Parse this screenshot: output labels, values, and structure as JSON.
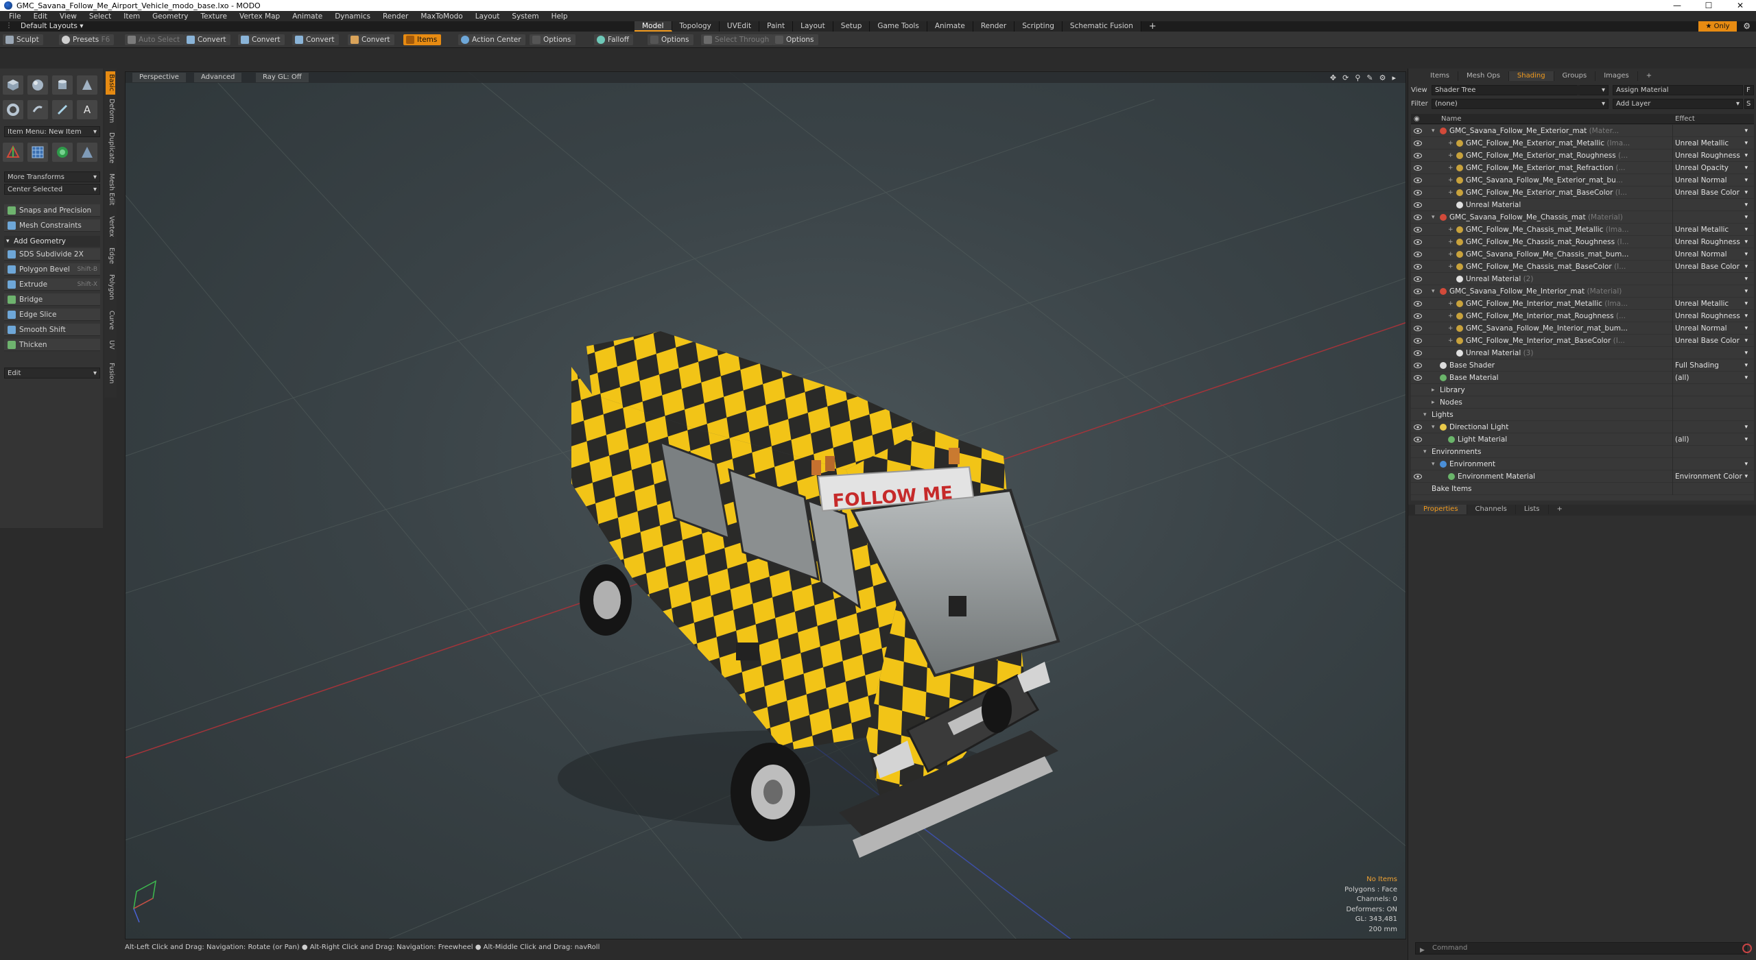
{
  "window": {
    "title": "GMC_Savana_Follow_Me_Airport_Vehicle_modo_base.lxo - MODO"
  },
  "menu": [
    "File",
    "Edit",
    "View",
    "Select",
    "Item",
    "Geometry",
    "Texture",
    "Vertex Map",
    "Animate",
    "Dynamics",
    "Render",
    "MaxToModo",
    "Layout",
    "System",
    "Help"
  ],
  "layout_bar": {
    "layout_select": "Default Layouts",
    "tabs": [
      "Model",
      "Topology",
      "UVEdit",
      "Paint",
      "Layout",
      "Setup",
      "Game Tools",
      "Animate",
      "Render",
      "Scripting",
      "Schematic Fusion"
    ],
    "active_tab": "Model",
    "add": "+",
    "only": "Only"
  },
  "toolbar": {
    "sculpt": "Sculpt",
    "presets": "Presets",
    "presets_key": "F6",
    "auto_select": "Auto Select",
    "convert": "Convert",
    "items": "Items",
    "action_center": "Action Center",
    "options": "Options",
    "falloff": "Falloff",
    "select_through": "Select Through"
  },
  "left_panel": {
    "vertical_tabs": [
      "Basic",
      "Deform",
      "Duplicate",
      "Mesh Edit",
      "Vertex",
      "Edge",
      "Polygon",
      "Curve",
      "UV",
      "Fusion"
    ],
    "item_menu": "Item Menu: New Item",
    "more_transforms": "More Transforms",
    "center_selected": "Center Selected",
    "snaps": "Snaps and Precision",
    "mesh_constraints": "Mesh Constraints",
    "add_geometry": "Add Geometry",
    "tools": [
      {
        "label": "SDS Subdivide 2X",
        "key": ""
      },
      {
        "label": "Polygon Bevel",
        "key": "Shift-B"
      },
      {
        "label": "Extrude",
        "key": "Shift-X"
      },
      {
        "label": "Bridge",
        "key": ""
      },
      {
        "label": "Edge Slice",
        "key": ""
      },
      {
        "label": "Smooth Shift",
        "key": ""
      },
      {
        "label": "Thicken",
        "key": ""
      }
    ],
    "edit": "Edit"
  },
  "viewport": {
    "tabs": [
      "Perspective",
      "Advanced",
      "Ray GL: Off"
    ],
    "sign_text": "FOLLOW ME",
    "hud": [
      "No Items",
      "Polygons : Face",
      "Channels: 0",
      "Deformers: ON",
      "GL: 343,481",
      "200 mm"
    ],
    "colors": {
      "checker_yellow": "#f2c417",
      "checker_dark": "#2a2a28",
      "grid": "#56615f",
      "x_axis": "#a4343a",
      "z_axis": "#3d4fa6"
    }
  },
  "status_bar": "Alt-Left Click and Drag: Navigation: Rotate (or Pan) ● Alt-Right Click and Drag: Navigation: Freewheel ● Alt-Middle Click and Drag: navRoll",
  "right_panel": {
    "tabs": [
      "Items",
      "Mesh Ops",
      "Shading",
      "Groups",
      "Images",
      "+"
    ],
    "active_tab": "Shading",
    "view_label": "View",
    "view_value": "Shader Tree",
    "assign_material": "Assign Material",
    "assign_key": "F",
    "filter_label": "Filter",
    "filter_value": "(none)",
    "add_layer": "Add Layer",
    "add_key": "S",
    "col_name": "Name",
    "col_effect": "Effect",
    "tree": [
      {
        "d": 1,
        "tw": "open",
        "icon": "#d24a3a",
        "name": "GMC_Savana_Follow_Me_Exterior_mat",
        "ann": " (Mater...",
        "fx": "",
        "eye": true
      },
      {
        "d": 3,
        "tw": "plus",
        "icon": "#c8a23c",
        "name": "GMC_Follow_Me_Exterior_mat_Metallic",
        "ann": " (Ima...",
        "fx": "Unreal Metallic",
        "eye": true
      },
      {
        "d": 3,
        "tw": "plus",
        "icon": "#c8a23c",
        "name": "GMC_Follow_Me_Exterior_mat_Roughness",
        "ann": " (...",
        "fx": "Unreal Roughness",
        "eye": true
      },
      {
        "d": 3,
        "tw": "plus",
        "icon": "#c8a23c",
        "name": "GMC_Follow_Me_Exterior_mat_Refraction",
        "ann": " (...",
        "fx": "Unreal Opacity",
        "eye": true
      },
      {
        "d": 3,
        "tw": "plus",
        "icon": "#c8a23c",
        "name": "GMC_Savana_Follow_Me_Exterior_mat_bu",
        "ann": "...",
        "fx": "Unreal Normal",
        "eye": true
      },
      {
        "d": 3,
        "tw": "plus",
        "icon": "#c8a23c",
        "name": "GMC_Follow_Me_Exterior_mat_BaseColor",
        "ann": " (I...",
        "fx": "Unreal Base Color",
        "eye": true
      },
      {
        "d": 3,
        "tw": "",
        "icon": "#e0e0e0",
        "name": "Unreal Material",
        "ann": "",
        "fx": "",
        "eye": true
      },
      {
        "d": 1,
        "tw": "open",
        "icon": "#d24a3a",
        "name": "GMC_Savana_Follow_Me_Chassis_mat",
        "ann": " (Material)",
        "fx": "",
        "eye": true
      },
      {
        "d": 3,
        "tw": "plus",
        "icon": "#c8a23c",
        "name": "GMC_Follow_Me_Chassis_mat_Metallic",
        "ann": " (Ima...",
        "fx": "Unreal Metallic",
        "eye": true
      },
      {
        "d": 3,
        "tw": "plus",
        "icon": "#c8a23c",
        "name": "GMC_Follow_Me_Chassis_mat_Roughness",
        "ann": " (I...",
        "fx": "Unreal Roughness",
        "eye": true
      },
      {
        "d": 3,
        "tw": "plus",
        "icon": "#c8a23c",
        "name": "GMC_Savana_Follow_Me_Chassis_mat_bum...",
        "ann": "",
        "fx": "Unreal Normal",
        "eye": true
      },
      {
        "d": 3,
        "tw": "plus",
        "icon": "#c8a23c",
        "name": "GMC_Follow_Me_Chassis_mat_BaseColor",
        "ann": " (I...",
        "fx": "Unreal Base Color",
        "eye": true
      },
      {
        "d": 3,
        "tw": "",
        "icon": "#e0e0e0",
        "name": "Unreal Material",
        "ann": " (2)",
        "fx": "",
        "eye": true
      },
      {
        "d": 1,
        "tw": "open",
        "icon": "#d24a3a",
        "name": "GMC_Savana_Follow_Me_Interior_mat",
        "ann": " (Material)",
        "fx": "",
        "eye": true
      },
      {
        "d": 3,
        "tw": "plus",
        "icon": "#c8a23c",
        "name": "GMC_Follow_Me_Interior_mat_Metallic",
        "ann": " (Ima...",
        "fx": "Unreal Metallic",
        "eye": true
      },
      {
        "d": 3,
        "tw": "plus",
        "icon": "#c8a23c",
        "name": "GMC_Follow_Me_Interior_mat_Roughness",
        "ann": " (...",
        "fx": "Unreal Roughness",
        "eye": true
      },
      {
        "d": 3,
        "tw": "plus",
        "icon": "#c8a23c",
        "name": "GMC_Savana_Follow_Me_Interior_mat_bum...",
        "ann": "",
        "fx": "Unreal Normal",
        "eye": true
      },
      {
        "d": 3,
        "tw": "plus",
        "icon": "#c8a23c",
        "name": "GMC_Follow_Me_Interior_mat_BaseColor",
        "ann": " (I...",
        "fx": "Unreal Base Color",
        "eye": true
      },
      {
        "d": 3,
        "tw": "",
        "icon": "#e0e0e0",
        "name": "Unreal Material",
        "ann": " (3)",
        "fx": "",
        "eye": true
      },
      {
        "d": 1,
        "tw": "",
        "icon": "#dcdcdc",
        "name": "Base Shader",
        "ann": "",
        "fx": "Full Shading",
        "eye": true
      },
      {
        "d": 1,
        "tw": "",
        "icon": "#6ab56a",
        "name": "Base Material",
        "ann": "",
        "fx": "(all)",
        "eye": true
      },
      {
        "d": 1,
        "tw": "closed",
        "icon": "",
        "name": "Library",
        "ann": "",
        "fx": "",
        "eye": false
      },
      {
        "d": 1,
        "tw": "closed",
        "icon": "",
        "name": "Nodes",
        "ann": "",
        "fx": "",
        "eye": false
      },
      {
        "d": 0,
        "tw": "open",
        "icon": "",
        "name": "Lights",
        "ann": "",
        "fx": "",
        "eye": false
      },
      {
        "d": 1,
        "tw": "open",
        "icon": "#e9c94a",
        "name": "Directional Light",
        "ann": "",
        "fx": "",
        "eye": true
      },
      {
        "d": 2,
        "tw": "",
        "icon": "#6ab56a",
        "name": "Light Material",
        "ann": "",
        "fx": "(all)",
        "eye": true
      },
      {
        "d": 0,
        "tw": "open",
        "icon": "",
        "name": "Environments",
        "ann": "",
        "fx": "",
        "eye": false
      },
      {
        "d": 1,
        "tw": "open",
        "icon": "#4a8fd8",
        "name": "Environment",
        "ann": "",
        "fx": "",
        "eye": false
      },
      {
        "d": 2,
        "tw": "",
        "icon": "#6ab56a",
        "name": "Environment Material",
        "ann": "",
        "fx": "Environment Color",
        "eye": true
      },
      {
        "d": 0,
        "tw": "",
        "icon": "",
        "name": "Bake Items",
        "ann": "",
        "fx": "",
        "eye": false
      }
    ],
    "prop_tabs": [
      "Properties",
      "Channels",
      "Lists",
      "+"
    ],
    "command_placeholder": "Command"
  }
}
